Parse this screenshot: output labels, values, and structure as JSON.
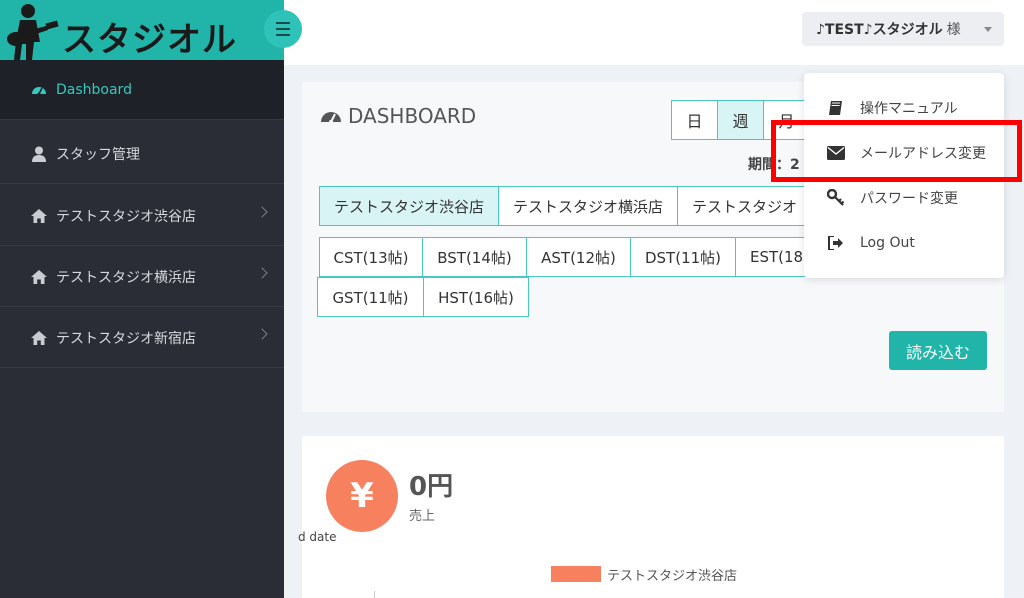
{
  "brand": {
    "logo_text": "スタジオル"
  },
  "sidebar": {
    "items": [
      {
        "label": "Dashboard"
      },
      {
        "label": "スタッフ管理"
      },
      {
        "label": "テストスタジオ渋谷店"
      },
      {
        "label": "テストスタジオ横浜店"
      },
      {
        "label": "テストスタジオ新宿店"
      }
    ]
  },
  "header": {
    "user_name": "♪TEST♪スタジオル",
    "user_suffix": "様"
  },
  "user_menu": {
    "items": [
      {
        "label": "操作マニュアル",
        "icon": "book-icon"
      },
      {
        "label": "メールアドレス変更",
        "icon": "envelope-icon"
      },
      {
        "label": "パスワード変更",
        "icon": "key-icon"
      },
      {
        "label": "Log Out",
        "icon": "sign-out-icon"
      }
    ]
  },
  "dashboard": {
    "title": "DASHBOARD",
    "period_buttons": [
      "日",
      "週",
      "月"
    ],
    "period_label": "期間：2",
    "stores": [
      "テストスタジオ渋谷店",
      "テストスタジオ横浜店",
      "テストスタジオ"
    ],
    "rooms_row1": [
      "CST(13帖)",
      "BST(14帖)",
      "AST(12帖)",
      "DST(11帖)",
      "EST(18"
    ],
    "rooms_row2": [
      "GST(11帖)",
      "HST(16帖)"
    ],
    "load_button": "読み込む"
  },
  "sales": {
    "symbol": "¥",
    "value": "0円",
    "label": "売上",
    "chart_axis_label": "d date",
    "legend": "テストスタジオ渋谷店"
  },
  "colors": {
    "accent": "#21b5aa",
    "sidebar_bg": "#2a2d36",
    "sales_circle": "#f7805f",
    "highlight": "#ff0000"
  }
}
